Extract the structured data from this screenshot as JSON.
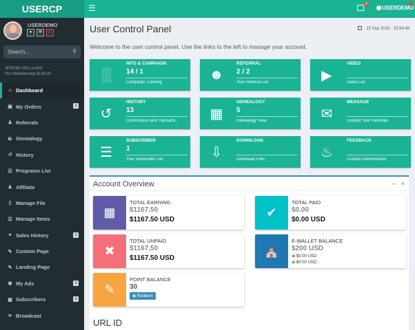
{
  "app": {
    "logo": "USERCP",
    "top_user": "USERDEMO"
  },
  "sidebar": {
    "username": "USERDEMO",
    "search_placeholder": "Search...",
    "member_name": "JEREMY WILLIAMS",
    "member_plan": "Pro Membership $149.00",
    "items": [
      {
        "label": "Dashboard",
        "icon": "home-icon",
        "badge": ""
      },
      {
        "label": "My Orders",
        "icon": "cart-icon",
        "badge": "1"
      },
      {
        "label": "Referrals",
        "icon": "users-icon",
        "badge": ""
      },
      {
        "label": "Genealogy",
        "icon": "tree-icon",
        "badge": ""
      },
      {
        "label": "History",
        "icon": "history-icon",
        "badge": ""
      },
      {
        "label": "Programs List",
        "icon": "list-icon",
        "badge": ""
      },
      {
        "label": "Affiliate",
        "icon": "affiliate-icon",
        "badge": ""
      },
      {
        "label": "Manage File",
        "icon": "file-icon",
        "badge": ""
      },
      {
        "label": "Manage Items",
        "icon": "items-icon",
        "badge": ""
      },
      {
        "label": "Sales History",
        "icon": "sales-icon",
        "badge": "1"
      },
      {
        "label": "Custom Page",
        "icon": "page-icon",
        "badge": ""
      },
      {
        "label": "Landing Page",
        "icon": "landing-icon",
        "badge": ""
      },
      {
        "label": "My Ads",
        "icon": "ads-icon",
        "badge": "1"
      },
      {
        "label": "Subscribers",
        "icon": "subscribers-icon",
        "badge": "1"
      },
      {
        "label": "Broadcast",
        "icon": "broadcast-icon",
        "badge": ""
      }
    ]
  },
  "header": {
    "title": "User Control Panel",
    "date": "15 Sep 2018 - 15:54:49",
    "welcome": "Welcome to the user control panel. Use the links to the left to manage your account."
  },
  "tiles": [
    {
      "title": "HITS & CAMPAIGN",
      "value": "14 / 1",
      "sub": "Campaign Tracking",
      "icon": "chart-icon"
    },
    {
      "title": "REFERRAL",
      "value": "2 / 2",
      "sub": "Your Referral List",
      "icon": "referral-icon"
    },
    {
      "title": "VIDEO",
      "value": "",
      "sub": "Video List",
      "icon": "video-icon"
    },
    {
      "title": "HISTORY",
      "value": "13",
      "sub": "Commission and Transacti...",
      "icon": "history-icon"
    },
    {
      "title": "GENEALOGY",
      "value": "5",
      "sub": "Genealogy View",
      "icon": "sitemap-icon"
    },
    {
      "title": "MESSAGE",
      "value": "",
      "sub": "Contact Your Referrals",
      "icon": "message-icon"
    },
    {
      "title": "SUBSCRIBER",
      "value": "1",
      "sub": "Your Subscriber List",
      "icon": "server-icon"
    },
    {
      "title": "DOWNLOAD",
      "value": "",
      "sub": "Download Files",
      "icon": "download-icon"
    },
    {
      "title": "FEEDBACK",
      "value": "",
      "sub": "Contact Administrator",
      "icon": "bell-icon"
    }
  ],
  "overview": {
    "title": "Account Overview",
    "earning": {
      "label": "TOTAL EARNING",
      "value": "$1167.50",
      "usd": "$1167.50 USD",
      "color": "#605ca8"
    },
    "paid": {
      "label": "TOTAL PAID",
      "value": "$0.00",
      "usd": "$0.00 USD",
      "color": "#00c0c8"
    },
    "unpaid": {
      "label": "TOTAL UNPAID",
      "value": "$1167.50",
      "usd": "$1167.50 USD",
      "color": "#f56f7a"
    },
    "ewallet": {
      "label": "E-WALLET BALANCE",
      "value": "$200 USD",
      "line1": "$0.00 USD",
      "line2": "$0.00 USD",
      "color": "#1f77b4"
    },
    "points": {
      "label": "POINT BALANCE",
      "value": "30",
      "redeem": "Redeem",
      "color": "#f7a541"
    }
  },
  "url_id": {
    "title": "URL ID"
  }
}
